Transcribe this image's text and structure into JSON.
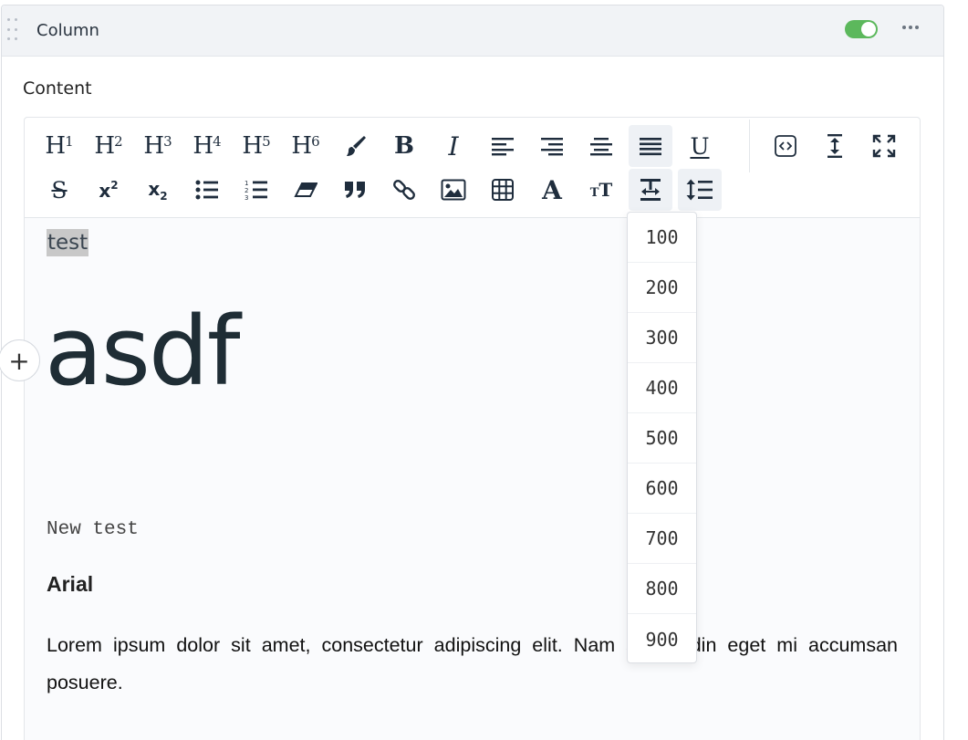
{
  "panel": {
    "title": "Column",
    "enabled": true,
    "accent_color": "#5cb85c"
  },
  "field": {
    "label": "Content"
  },
  "toolbar": {
    "row1": [
      {
        "name": "h1-button",
        "icon": "heading-1-icon",
        "text": "H",
        "sup": "1"
      },
      {
        "name": "h2-button",
        "icon": "heading-2-icon",
        "text": "H",
        "sup": "2"
      },
      {
        "name": "h3-button",
        "icon": "heading-3-icon",
        "text": "H",
        "sup": "3"
      },
      {
        "name": "h4-button",
        "icon": "heading-4-icon",
        "text": "H",
        "sup": "4"
      },
      {
        "name": "h5-button",
        "icon": "heading-5-icon",
        "text": "H",
        "sup": "5"
      },
      {
        "name": "h6-button",
        "icon": "heading-6-icon",
        "text": "H",
        "sup": "6"
      },
      {
        "name": "text-color-button",
        "icon": "paint-brush-icon"
      },
      {
        "name": "bold-button",
        "icon": "bold-icon",
        "text": "B"
      },
      {
        "name": "italic-button",
        "icon": "italic-icon",
        "text": "I"
      },
      {
        "name": "align-left-button",
        "icon": "align-left-icon"
      },
      {
        "name": "align-right-button",
        "icon": "align-right-icon"
      },
      {
        "name": "align-center-button",
        "icon": "align-center-icon"
      },
      {
        "name": "align-justify-button",
        "icon": "align-justify-icon",
        "active": true
      },
      {
        "name": "underline-button",
        "icon": "underline-icon",
        "text": "U"
      },
      {
        "name": "source-code-button",
        "icon": "code-icon"
      },
      {
        "name": "auto-height-button",
        "icon": "vertical-resize-icon"
      },
      {
        "name": "fullscreen-button",
        "icon": "expand-icon"
      }
    ],
    "row2": [
      {
        "name": "strikethrough-button",
        "icon": "strikethrough-icon",
        "text": "S"
      },
      {
        "name": "superscript-button",
        "icon": "superscript-icon",
        "text": "x",
        "sup": "2"
      },
      {
        "name": "subscript-button",
        "icon": "subscript-icon",
        "text": "x",
        "sub": "2"
      },
      {
        "name": "bullet-list-button",
        "icon": "list-bullet-icon"
      },
      {
        "name": "numbered-list-button",
        "icon": "list-numbered-icon"
      },
      {
        "name": "clear-format-button",
        "icon": "eraser-icon"
      },
      {
        "name": "blockquote-button",
        "icon": "quote-icon"
      },
      {
        "name": "link-button",
        "icon": "link-icon"
      },
      {
        "name": "image-button",
        "icon": "image-icon"
      },
      {
        "name": "table-button",
        "icon": "table-icon"
      },
      {
        "name": "font-family-button",
        "icon": "font-icon",
        "text": "A"
      },
      {
        "name": "font-size-button",
        "icon": "text-size-icon",
        "text": "T",
        "small": "T"
      },
      {
        "name": "font-weight-button",
        "icon": "font-weight-icon",
        "active": true
      },
      {
        "name": "line-height-button",
        "icon": "line-height-icon",
        "active": true
      }
    ]
  },
  "content": {
    "highlighted_text": "test",
    "big_heading": "asdf",
    "mono_line": "New test",
    "arial_heading": "Arial",
    "paragraph": "Lorem ipsum dolor sit amet, consectetur adipiscing elit. Nam sollicitudin eget mi accumsan posuere."
  },
  "insert_button": "+",
  "font_weight_menu": {
    "options": [
      "100",
      "200",
      "300",
      "400",
      "500",
      "600",
      "700",
      "800",
      "900"
    ]
  }
}
